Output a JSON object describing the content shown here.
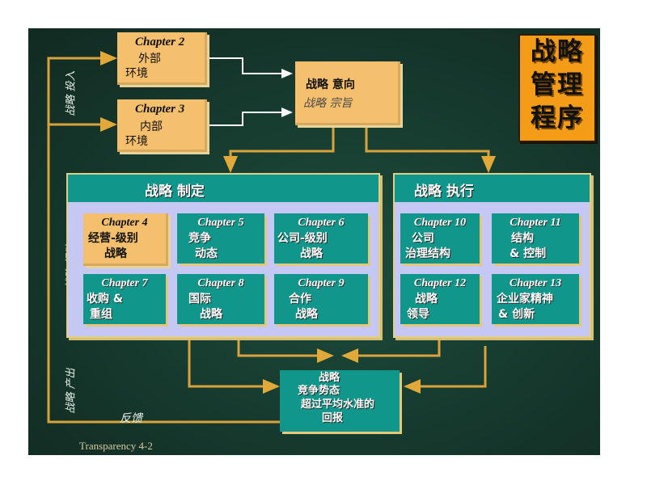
{
  "title_box": {
    "lines": [
      "战略",
      "管理",
      "程序"
    ]
  },
  "side_labels": {
    "inputs": "战略 投入",
    "actions": "战略 行动",
    "outputs": "战略 产出",
    "feedback": "反馈"
  },
  "inputs": [
    {
      "chapter": "Chapter 2",
      "line1": "外部",
      "line2": "环境"
    },
    {
      "chapter": "Chapter 3",
      "line1": "内部",
      "line2": "环境"
    }
  ],
  "intent_box": {
    "line1": "战略 意向",
    "line2": "战略 宗旨"
  },
  "formulation": {
    "title": "战略 制定",
    "chapters": [
      {
        "chapter": "Chapter 4",
        "line1": "经营-级别",
        "line2": "战略",
        "highlight": true
      },
      {
        "chapter": "Chapter 5",
        "line1": "竞争",
        "line2": "动态"
      },
      {
        "chapter": "Chapter 6",
        "line1": "公司-级别",
        "line2": "战略"
      },
      {
        "chapter": "Chapter 7",
        "line1": "收购 &",
        "line2": "重组"
      },
      {
        "chapter": "Chapter 8",
        "line1": "国际",
        "line2": "战略"
      },
      {
        "chapter": "Chapter 9",
        "line1": "合作",
        "line2": "战略"
      }
    ]
  },
  "implementation": {
    "title": "战略 执行",
    "chapters": [
      {
        "chapter": "Chapter 10",
        "line1": "公司",
        "line2": "治理结构"
      },
      {
        "chapter": "Chapter 11",
        "line1": "结构",
        "line2": "& 控制"
      },
      {
        "chapter": "Chapter 12",
        "line1": "战略",
        "line2": "领导"
      },
      {
        "chapter": "Chapter 13",
        "line1": "企业家精神",
        "line2": "& 创新"
      }
    ]
  },
  "outcome_box": {
    "lines": [
      "战略",
      "竞争势态",
      "超过平均水准的",
      "回报"
    ]
  },
  "footer": "Transparency 4-2",
  "colors": {
    "board": "#173c30",
    "tan": "#f5c06d",
    "teal": "#10968a",
    "panel": "#c6c8f4",
    "title": "#f49b18",
    "arrow": "#d9a23a"
  }
}
